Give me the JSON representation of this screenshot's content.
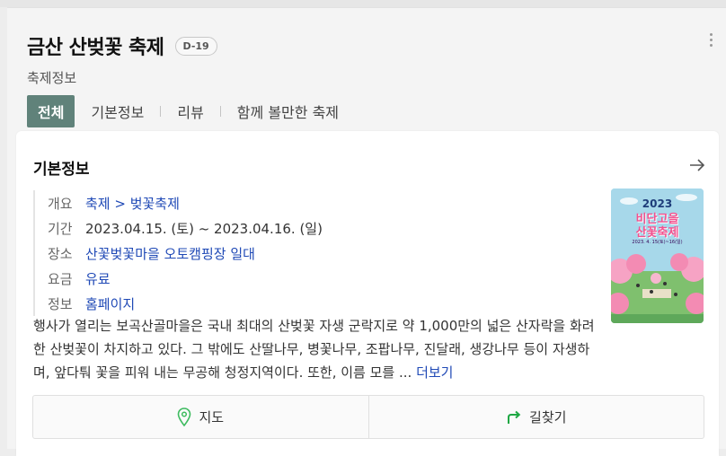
{
  "header": {
    "title": "금산 산벚꽃 축제",
    "dday": "D-19",
    "category": "축제정보"
  },
  "tabs": [
    {
      "label": "전체",
      "active": true
    },
    {
      "label": "기본정보",
      "active": false
    },
    {
      "label": "리뷰",
      "active": false
    },
    {
      "label": "함께 볼만한 축제",
      "active": false
    }
  ],
  "card": {
    "title": "기본정보",
    "rows": [
      {
        "label": "개요",
        "value": "축제 > 벚꽃축제"
      },
      {
        "label": "기간",
        "value": "2023.04.15. (토) ~  2023.04.16. (일)"
      },
      {
        "label": "장소",
        "value": "산꽃벚꽃마을 오토캠핑장 일대"
      },
      {
        "label": "요금",
        "value": "유료"
      },
      {
        "label": "정보",
        "value": "홈페이지"
      }
    ],
    "description": "행사가 열리는 보곡산골마을은 국내 최대의 산벚꽃 자생 군락지로 약 1,000만의 넓은 산자락을 화려한 산벚꽃이 차지하고 있다. 그 밖에도 산딸나무, 병꽃나무, 조팝나무, 진달래, 생강나무 등이 자생하며, 앞다퉈 꽃을 피워 내는 무공해 청정지역이다. 또한, 이름 모를 ...",
    "more_label": "더보기",
    "poster": {
      "year": "2023",
      "title_line1": "비단고을",
      "title_line2": "산꽃축제",
      "date": "2023. 4. 15(토)~16(일)"
    }
  },
  "actions": {
    "map_label": "지도",
    "directions_label": "길찾기"
  },
  "colors": {
    "active_tab": "#60827a",
    "link": "#1f49b6",
    "map_icon": "#3dbb5f",
    "directions_icon": "#1fa844"
  }
}
